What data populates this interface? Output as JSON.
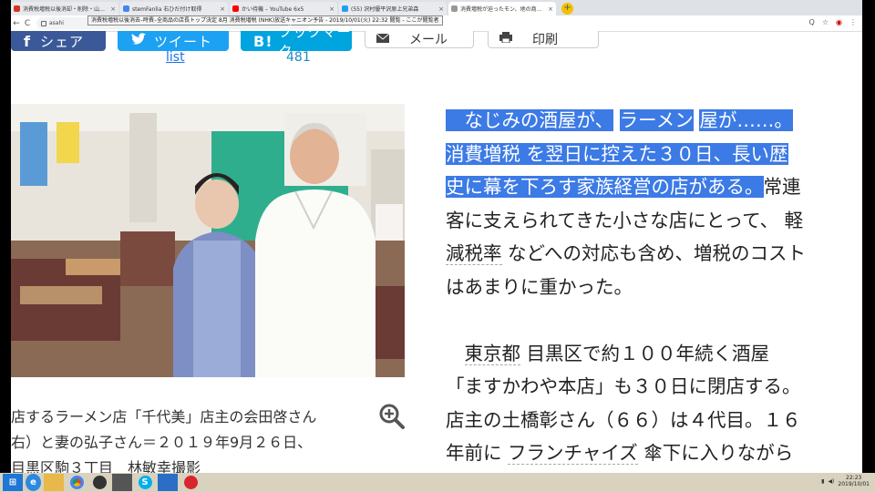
{
  "browser": {
    "tabs": [
      {
        "title": "消費税増税以後消却・削除・山部ハル主",
        "color": "#d93025",
        "active": false
      },
      {
        "title": "stemFanlia 右ひだ付け取得",
        "color": "#4285f4",
        "active": false
      },
      {
        "title": "かい待機 – YouTube 6x5",
        "color": "#ff0000",
        "active": false
      },
      {
        "title": "(55) 沢村優平沢原上兄弟森",
        "color": "#1da1f2",
        "active": false
      },
      {
        "title": "消費増税が迫ったモン、地の商店 消費増",
        "color": "#999999",
        "active": true
      }
    ],
    "new_tab": "+",
    "back": "←",
    "reload": "C",
    "url": "asahi",
    "tooltip": "消費税増税以後消去–時費–全商品の店長トップ決定 8月 消費税増税 (NHK)放送キャニオン予告 - 2019/10/01(火) 22:32 閲覧 - ここが閲覧者",
    "right_tools": [
      "Q",
      "☆",
      "◉",
      "⋮"
    ]
  },
  "share": {
    "facebook_label": "シェア",
    "twitter_label": "ツイート",
    "hatena_label": "ブックマーク",
    "mail_label": "メール",
    "print_label": "印刷",
    "twitter_count": "list",
    "hatena_count": "481",
    "colors": {
      "facebook": "#3b5998",
      "twitter": "#1da1f2",
      "hatena": "#00a4de"
    }
  },
  "photo": {
    "caption_lines": [
      "店するラーメン店「千代美」店主の会田啓さん",
      "右）と妻の弘子さん＝２０１９年9月２６日、",
      "目黒区駒３丁目　林敏幸撮影"
    ],
    "zoom_icon": "zoom-in-icon"
  },
  "article": {
    "lines": [
      [
        {
          "t": "　なじみの酒屋が、",
          "hl": true
        },
        {
          "t": " ",
          "hl": false
        },
        {
          "t": "ラーメン",
          "hl": true
        },
        {
          "t": " ",
          "hl": false
        },
        {
          "t": "屋が……。",
          "hl": true
        }
      ],
      [
        {
          "t": " 消費増税 ",
          "hl": true
        },
        {
          "t": " ",
          "hl": false
        },
        {
          "t": "を翌日に控えた３０日、長い歴",
          "hl": true
        }
      ],
      [
        {
          "t": "史に幕を下ろす家族経営の店がある。",
          "hl": true
        },
        {
          "t": "常連",
          "hl": false
        }
      ],
      [
        {
          "t": "客に支えられてきた小さな店にとって、 軽",
          "hl": false
        }
      ],
      [
        {
          "t": "減税率",
          "hl": false,
          "ul": true
        },
        {
          "t": " などへの対応も含め、増税のコスト",
          "hl": false
        }
      ],
      [
        {
          "t": "はあまりに重かった。",
          "hl": false
        }
      ],
      [
        {
          "t": "",
          "hl": false
        }
      ],
      [
        {
          "t": "　",
          "hl": false
        },
        {
          "t": "東京都",
          "hl": false,
          "ul": true
        },
        {
          "t": " 目黒区で約１００年続く酒屋",
          "hl": false
        }
      ],
      [
        {
          "t": "「ますかわや本店」も３０日に閉店する。",
          "hl": false
        }
      ],
      [
        {
          "t": "店主の土橋彰さん（６６）は４代目。１６",
          "hl": false
        }
      ],
      [
        {
          "t": "年前に ",
          "hl": false
        },
        {
          "t": "フランチャイズ",
          "hl": false,
          "ul": true
        },
        {
          "t": " 傘下に入りながら",
          "hl": false
        }
      ]
    ]
  },
  "taskbar": {
    "clock_time": "22:23",
    "clock_date": "2019/10/01",
    "icons": [
      "start-icon",
      "explorer-icon",
      "folder-icon",
      "chrome-icon",
      "obs-icon",
      "camera-icon",
      "skype-icon",
      "mail-icon",
      "browser-icon"
    ]
  }
}
